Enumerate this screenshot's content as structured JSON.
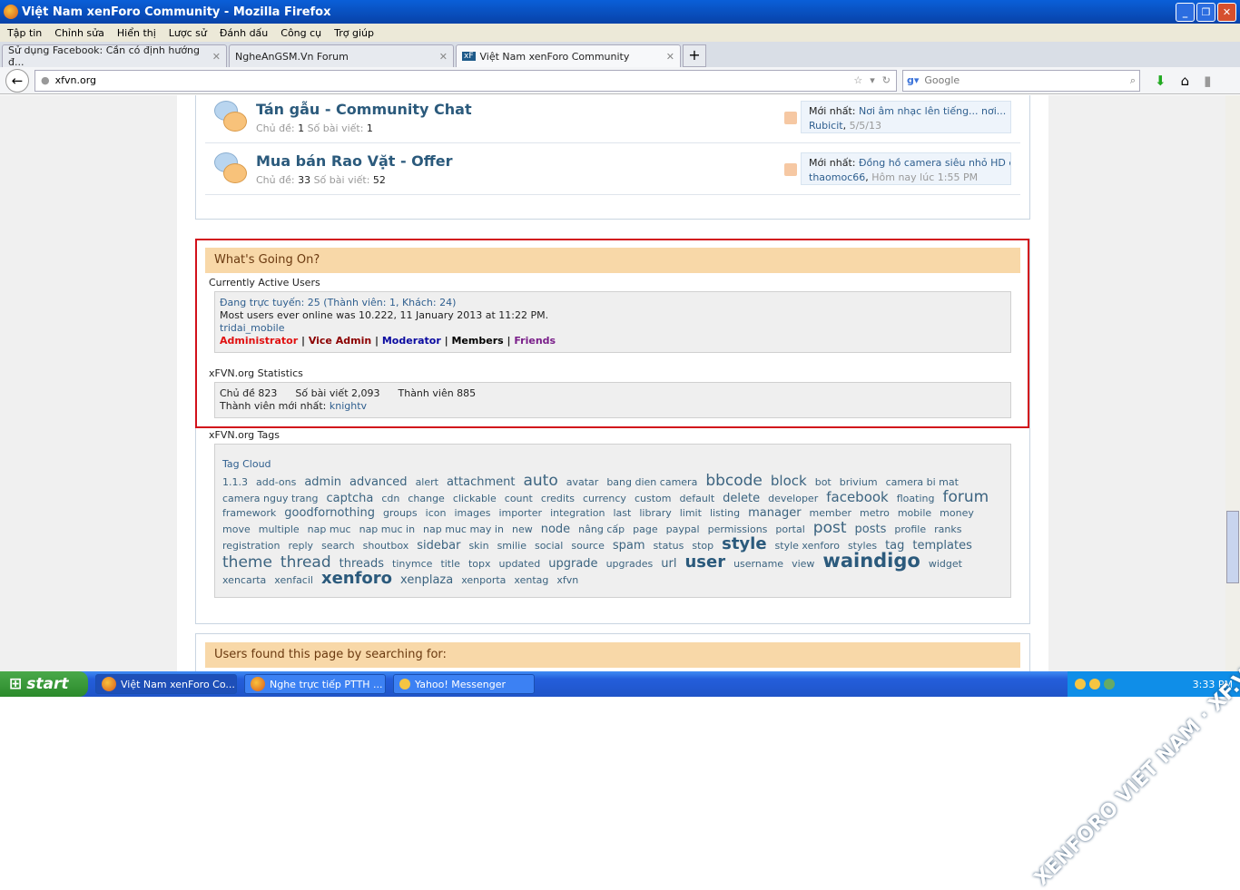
{
  "window": {
    "title": "Việt Nam xenForo Community - Mozilla Firefox",
    "buttons": [
      "_",
      "❐",
      "✕"
    ]
  },
  "menu": [
    "Tập tin",
    "Chỉnh sửa",
    "Hiển thị",
    "Lược sử",
    "Đánh dấu",
    "Công cụ",
    "Trợ giúp"
  ],
  "tabs": [
    {
      "label": "Sử dụng Facebook: Cần có định hướng đ..."
    },
    {
      "label": "NgheAnGSM.Vn Forum"
    },
    {
      "label": "Việt Nam xenForo Community",
      "active": true
    }
  ],
  "address": {
    "url": "xfvn.org",
    "search_placeholder": "Google"
  },
  "forums": [
    {
      "title": "Tán gẫu - Community Chat",
      "threads_label": "Chủ đề:",
      "threads": "1",
      "posts_label": "Số bài viết:",
      "posts": "1",
      "latest_label": "Mới nhất:",
      "latest_title": "Nơi âm nhạc lên tiếng... nơi...",
      "latest_user": "Rubicit",
      "latest_date": "5/5/13"
    },
    {
      "title": "Mua bán Rao Vặt - Offer",
      "threads_label": "Chủ đề:",
      "threads": "33",
      "posts_label": "Số bài viết:",
      "posts": "52",
      "latest_label": "Mới nhất:",
      "latest_title": "Đồng hồ camera siêu nhỏ HD đa...",
      "latest_user": "thaomoc66",
      "latest_date": "Hôm nay lúc 1:55 PM"
    }
  ],
  "whats_going_on": {
    "title": "What's Going On?",
    "active_users": {
      "heading": "Currently Active Users",
      "online": "Đang trực tuyến: 25 (Thành viên: 1, Khách: 24)",
      "record": "Most users ever online was 10.222, 11 January 2013 at 11:22 PM.",
      "user": "tridai_mobile",
      "groups": [
        {
          "label": "Administrator",
          "color": "#e01010"
        },
        {
          "label": "Vice Admin",
          "color": "#8b0000"
        },
        {
          "label": "Moderator",
          "color": "#0a0aa0"
        },
        {
          "label": "Members",
          "color": "#000000"
        },
        {
          "label": "Friends",
          "color": "#7a1f8a"
        }
      ]
    },
    "stats": {
      "heading": "xFVN.org Statistics",
      "threads": "Chủ đề 823",
      "posts": "Số bài viết 2,093",
      "members": "Thành viên 885",
      "newest_label": "Thành viên mới nhất:",
      "newest": "knightv"
    }
  },
  "tags": {
    "heading": "xFVN.org Tags",
    "cloud_label": "Tag Cloud",
    "items": [
      [
        "1.1.3",
        1
      ],
      [
        "add-ons",
        1
      ],
      [
        "admin",
        2
      ],
      [
        "advanced",
        2
      ],
      [
        "alert",
        1
      ],
      [
        "attachment",
        2
      ],
      [
        "auto",
        4
      ],
      [
        "avatar",
        1
      ],
      [
        "bang dien camera",
        1
      ],
      [
        "bbcode",
        4
      ],
      [
        "block",
        3
      ],
      [
        "bot",
        1
      ],
      [
        "brivium",
        1
      ],
      [
        "camera bi mat",
        1
      ],
      [
        "camera nguy trang",
        1
      ],
      [
        "captcha",
        2
      ],
      [
        "cdn",
        1
      ],
      [
        "change",
        1
      ],
      [
        "clickable",
        1
      ],
      [
        "count",
        1
      ],
      [
        "credits",
        1
      ],
      [
        "currency",
        1
      ],
      [
        "custom",
        1
      ],
      [
        "default",
        1
      ],
      [
        "delete",
        2
      ],
      [
        "developer",
        1
      ],
      [
        "facebook",
        3
      ],
      [
        "floating",
        1
      ],
      [
        "forum",
        4
      ],
      [
        "framework",
        1
      ],
      [
        "goodfornothing",
        2
      ],
      [
        "groups",
        1
      ],
      [
        "icon",
        1
      ],
      [
        "images",
        1
      ],
      [
        "importer",
        1
      ],
      [
        "integration",
        1
      ],
      [
        "last",
        1
      ],
      [
        "library",
        1
      ],
      [
        "limit",
        1
      ],
      [
        "listing",
        1
      ],
      [
        "manager",
        2
      ],
      [
        "member",
        1
      ],
      [
        "metro",
        1
      ],
      [
        "mobile",
        1
      ],
      [
        "money",
        1
      ],
      [
        "move",
        1
      ],
      [
        "multiple",
        1
      ],
      [
        "nap muc",
        1
      ],
      [
        "nap muc in",
        1
      ],
      [
        "nap muc may in",
        1
      ],
      [
        "new",
        1
      ],
      [
        "node",
        2
      ],
      [
        "nâng cấp",
        1
      ],
      [
        "page",
        1
      ],
      [
        "paypal",
        1
      ],
      [
        "permissions",
        1
      ],
      [
        "portal",
        1
      ],
      [
        "post",
        4
      ],
      [
        "posts",
        2
      ],
      [
        "profile",
        1
      ],
      [
        "ranks",
        1
      ],
      [
        "registration",
        1
      ],
      [
        "reply",
        1
      ],
      [
        "search",
        1
      ],
      [
        "shoutbox",
        1
      ],
      [
        "sidebar",
        2
      ],
      [
        "skin",
        1
      ],
      [
        "smilie",
        1
      ],
      [
        "social",
        1
      ],
      [
        "source",
        1
      ],
      [
        "spam",
        2
      ],
      [
        "status",
        1
      ],
      [
        "stop",
        1
      ],
      [
        "style",
        5
      ],
      [
        "style xenforo",
        1
      ],
      [
        "styles",
        1
      ],
      [
        "tag",
        2
      ],
      [
        "templates",
        2
      ],
      [
        "theme",
        4
      ],
      [
        "thread",
        4
      ],
      [
        "threads",
        2
      ],
      [
        "tinymce",
        1
      ],
      [
        "title",
        1
      ],
      [
        "topx",
        1
      ],
      [
        "updated",
        1
      ],
      [
        "upgrade",
        2
      ],
      [
        "upgrades",
        1
      ],
      [
        "url",
        2
      ],
      [
        "user",
        5
      ],
      [
        "username",
        1
      ],
      [
        "view",
        1
      ],
      [
        "waindigo",
        6
      ],
      [
        "widget",
        1
      ],
      [
        "xencarta",
        1
      ],
      [
        "xenfacil",
        1
      ],
      [
        "xenforo",
        5
      ],
      [
        "xenplaza",
        2
      ],
      [
        "xenporta",
        1
      ],
      [
        "xentag",
        1
      ],
      [
        "xfvn",
        1
      ]
    ]
  },
  "search_box": {
    "title": "Users found this page by searching for:"
  },
  "taskbar": {
    "start": "start",
    "tasks": [
      "Việt Nam xenForo Co...",
      "Nghe trực tiếp PTTH ...",
      "Yahoo! Messenger"
    ],
    "clock": "3:33 PM"
  },
  "watermark": "XENFORO VIET NAM · XF.VN",
  "colors": {
    "highlight_border": "#d2111b",
    "header_bg": "#f8d8a8",
    "link": "#2f5f8f"
  }
}
